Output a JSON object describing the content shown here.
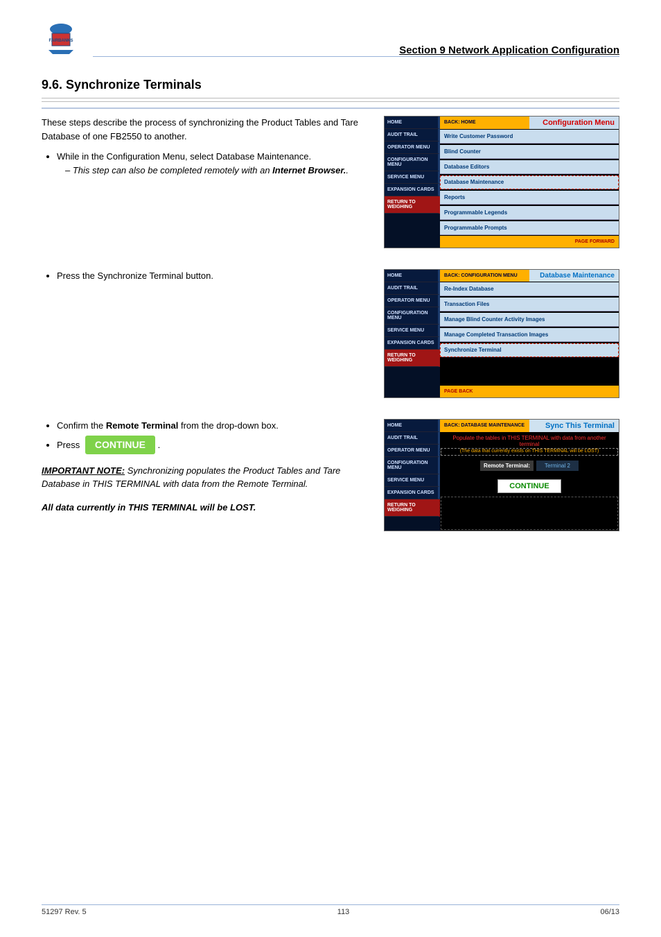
{
  "header": {
    "section_title": "Section 9 Network Application Configuration",
    "logo_alt": "FAIRBANKS Scales"
  },
  "section": {
    "number": "9.6.",
    "title": "Synchronize Terminals"
  },
  "intro": "These steps describe the process of synchronizing the Product Tables and Tare Database of one FB2550 to another.",
  "steps_a": {
    "s1": "While in the Configuration Menu, select Database Maintenance.",
    "s1_note_em": "This step can also be completed remotely with an",
    "s1_note_bold": "Internet Browser."
  },
  "steps_b": {
    "s2": "Press the Synchronize Terminal button."
  },
  "steps_c": {
    "s3_pre": "Confirm the",
    "s3_bold": "Remote Terminal",
    "s3_post": "from the drop-down box.",
    "s4_pre": "Press",
    "s4_badge": "CONTINUE",
    "note_label": "IMPORTANT NOTE:",
    "note_text": "Synchronizing populates the Product Tables and Tare Database in THIS TERMINAL with data from the Remote Terminal.",
    "warn": "All data currently in THIS TERMINAL will be LOST."
  },
  "ss1": {
    "sidebar": [
      "HOME",
      "AUDIT TRAIL",
      "OPERATOR MENU",
      "CONFIGURATION MENU",
      "SERVICE MENU",
      "EXPANSION CARDS",
      "RETURN TO WEIGHING"
    ],
    "back": "BACK: HOME",
    "title": "Configuration Menu",
    "items": [
      "Write Customer Password",
      "Blind Counter",
      "Database Editors",
      "Database Maintenance",
      "Reports",
      "Programmable Legends",
      "Programmable Prompts"
    ],
    "fwd": "PAGE FORWARD"
  },
  "ss2": {
    "sidebar": [
      "HOME",
      "AUDIT TRAIL",
      "OPERATOR MENU",
      "CONFIGURATION MENU",
      "SERVICE MENU",
      "EXPANSION CARDS",
      "RETURN TO WEIGHING"
    ],
    "back": "BACK: CONFIGURATION MENU",
    "title": "Database Maintenance",
    "items": [
      "Re-Index Database",
      "Transaction Files",
      "Manage Blind Counter Activity Images",
      "Manage Completed Transaction Images",
      "Synchronize Terminal"
    ],
    "back_btn": "PAGE BACK"
  },
  "ss3": {
    "sidebar": [
      "HOME",
      "AUDIT TRAIL",
      "OPERATOR MENU",
      "CONFIGURATION MENU",
      "SERVICE MENU",
      "EXPANSION CARDS",
      "RETURN TO WEIGHING"
    ],
    "back": "BACK: DATABASE MAINTENANCE",
    "title": "Sync This Terminal",
    "notice1": "Populate the tables in THIS TERMINAL with data from another terminal",
    "notice2": "(The data that currently exists on THIS TERMINAL will be LOST)",
    "field_label": "Remote Terminal:",
    "field_value": "Terminal 2",
    "continue": "CONTINUE"
  },
  "footer": {
    "left": "51297 Rev. 5",
    "mid": "113",
    "right": "06/13"
  }
}
